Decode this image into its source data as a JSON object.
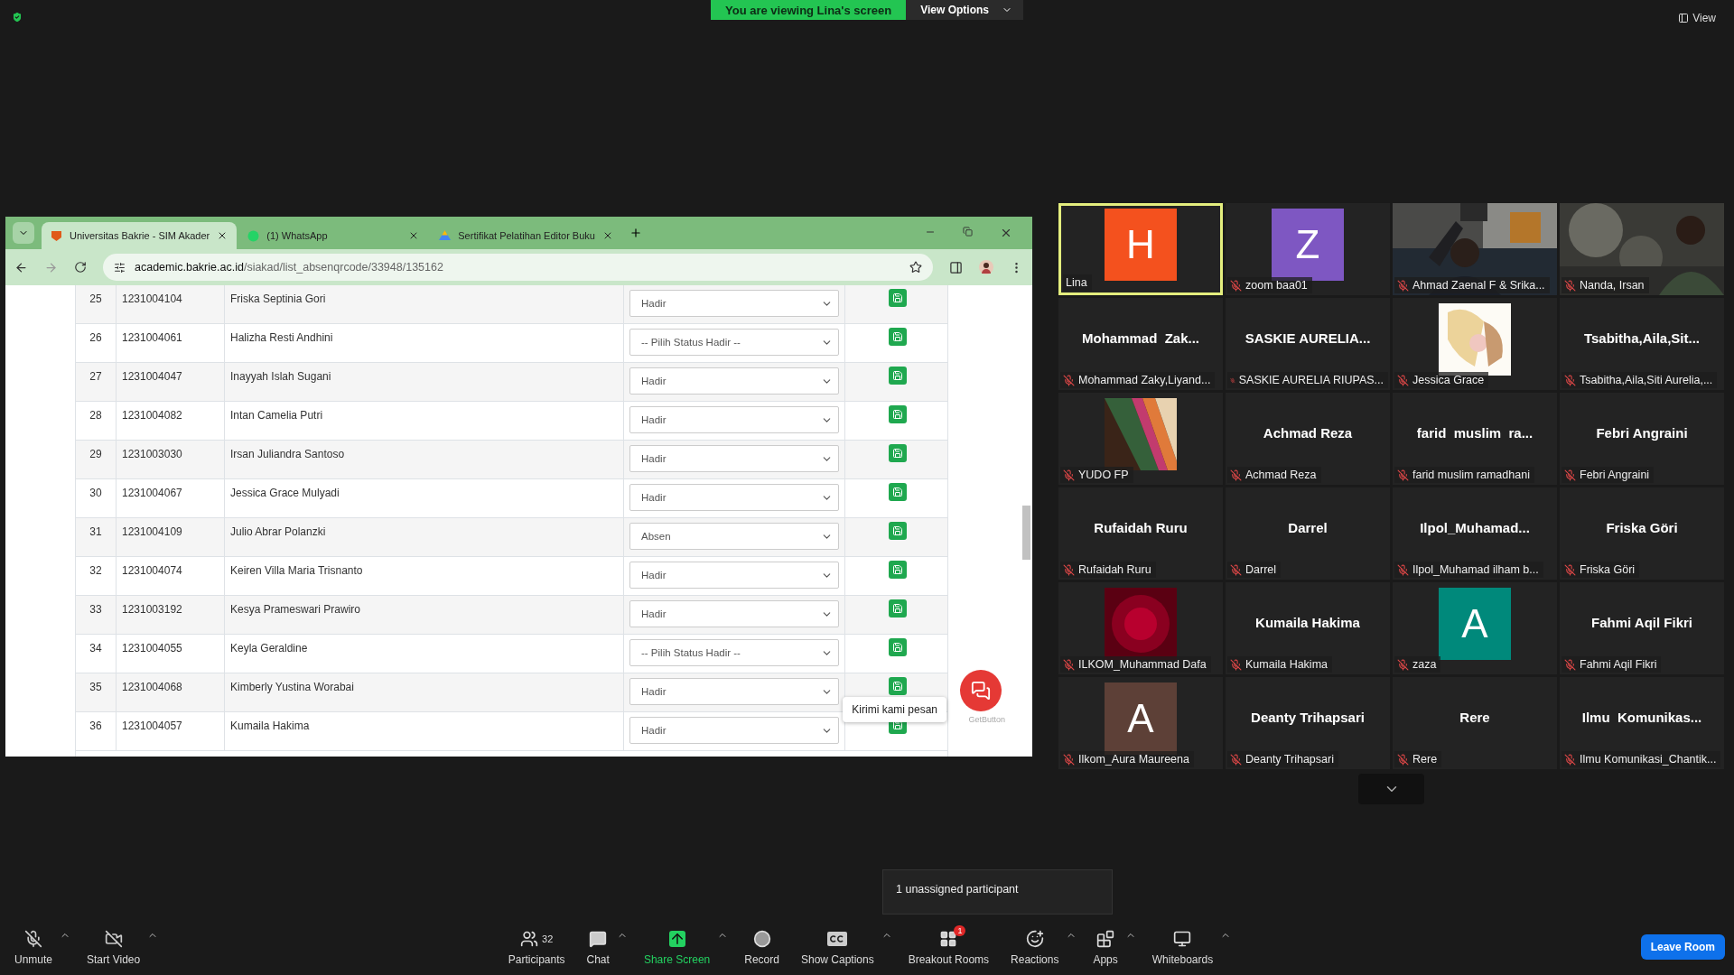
{
  "top_bar": {
    "viewing_label": "You are viewing Lina's screen",
    "view_options": "View Options",
    "view_button": "View"
  },
  "browser": {
    "tabs": [
      {
        "title": "Universitas Bakrie - SIM Akader",
        "selected": true,
        "kind": "shield"
      },
      {
        "title": "(1) WhatsApp",
        "selected": false,
        "kind": "chat"
      },
      {
        "title": "Sertifikat Pelatihan Editor Buku",
        "selected": false,
        "kind": "drive"
      }
    ],
    "url_host": "academic.bakrie.ac.id",
    "url_path": "/siakad/list_absenqrcode/33948/135162"
  },
  "table": {
    "rows": [
      {
        "no": "25",
        "nim": "1231004104",
        "name": "Friska Septinia Gori",
        "status": "Hadir"
      },
      {
        "no": "26",
        "nim": "1231004061",
        "name": "Halizha Resti Andhini",
        "status": "-- Pilih Status Hadir --"
      },
      {
        "no": "27",
        "nim": "1231004047",
        "name": "Inayyah Islah Sugani",
        "status": "Hadir"
      },
      {
        "no": "28",
        "nim": "1231004082",
        "name": "Intan Camelia Putri",
        "status": "Hadir"
      },
      {
        "no": "29",
        "nim": "1231003030",
        "name": "Irsan Juliandra Santoso",
        "status": "Hadir"
      },
      {
        "no": "30",
        "nim": "1231004067",
        "name": "Jessica Grace Mulyadi",
        "status": "Hadir"
      },
      {
        "no": "31",
        "nim": "1231004109",
        "name": "Julio Abrar Polanzki",
        "status": "Absen"
      },
      {
        "no": "32",
        "nim": "1231004074",
        "name": "Keiren Villa Maria Trisnanto",
        "status": "Hadir"
      },
      {
        "no": "33",
        "nim": "1231003192",
        "name": "Kesya Prameswari Prawiro",
        "status": "Hadir"
      },
      {
        "no": "34",
        "nim": "1231004055",
        "name": "Keyla Geraldine",
        "status": "-- Pilih Status Hadir --"
      },
      {
        "no": "35",
        "nim": "1231004068",
        "name": "Kimberly Yustina Worabai",
        "status": "Hadir"
      },
      {
        "no": "36",
        "nim": "1231004057",
        "name": "Kumaila Hakima",
        "status": "Hadir"
      }
    ]
  },
  "chat_widget": {
    "tooltip": "Kirimi kami pesan",
    "brand": "GetButton"
  },
  "participants": [
    {
      "kind": "avatar",
      "letter": "H",
      "color": "#f4511e",
      "label": "Lina",
      "muted": false,
      "speaking": true
    },
    {
      "kind": "avatar",
      "letter": "Z",
      "color": "#7e57c2",
      "label": "zoom baa01",
      "muted": true,
      "speaking": false
    },
    {
      "kind": "video",
      "label": "Ahmad Zaenal F & Srika...",
      "muted": true,
      "speaking": false
    },
    {
      "kind": "video",
      "label": "Nanda, Irsan",
      "muted": true,
      "speaking": false
    },
    {
      "kind": "name",
      "name": "Mohammad  Zak...",
      "label": "Mohammad Zaky,Liyand...",
      "muted": true,
      "speaking": false
    },
    {
      "kind": "name",
      "name": "SASKIE AURELIA...",
      "label": "SASKIE AURELIA RIUPAS...",
      "muted": true,
      "speaking": false
    },
    {
      "label": "Jessica Grace",
      "muted": true,
      "speaking": false
    },
    {
      "kind": "name",
      "name": "Tsabitha,Aila,Sit...",
      "label": "Tsabitha,Aila,Siti Aurelia,...",
      "muted": true,
      "speaking": false
    },
    {
      "label": "YUDO FP",
      "muted": true,
      "speaking": false
    },
    {
      "kind": "name",
      "name": "Achmad Reza",
      "label": "Achmad Reza",
      "muted": true,
      "speaking": false
    },
    {
      "kind": "name",
      "name": "farid  muslim  ra...",
      "label": "farid muslim ramadhani",
      "muted": true,
      "speaking": false
    },
    {
      "kind": "name",
      "name": "Febri Angraini",
      "label": "Febri Angraini",
      "muted": true,
      "speaking": false
    },
    {
      "kind": "name",
      "name": "Rufaidah Ruru",
      "label": "Rufaidah Ruru",
      "muted": true,
      "speaking": false
    },
    {
      "kind": "name",
      "name": "Darrel",
      "label": "Darrel",
      "muted": true,
      "speaking": false
    },
    {
      "kind": "name",
      "name": "Ilpol_Muhamad...",
      "label": "Ilpol_Muhamad ilham b...",
      "muted": true,
      "speaking": false
    },
    {
      "kind": "name",
      "name": "Friska Göri",
      "label": "Friska Göri",
      "muted": true,
      "speaking": false
    },
    {
      "label": "ILKOM_Muhammad Dafa",
      "muted": true,
      "speaking": false
    },
    {
      "kind": "name",
      "name": "Kumaila Hakima",
      "label": "Kumaila Hakima",
      "muted": true,
      "speaking": false
    },
    {
      "kind": "avatar",
      "letter": "A",
      "color": "#00897b",
      "label": "zaza",
      "muted": true,
      "speaking": false
    },
    {
      "kind": "name",
      "name": "Fahmi Aqil Fikri",
      "label": "Fahmi Aqil Fikri",
      "muted": true,
      "speaking": false
    },
    {
      "kind": "avatar",
      "letter": "A",
      "color": "#5d4037",
      "label": "Ilkom_Aura Maureena",
      "muted": true,
      "speaking": false
    },
    {
      "kind": "name",
      "name": "Deanty Trihapsari",
      "label": "Deanty Trihapsari",
      "muted": true,
      "speaking": false
    },
    {
      "kind": "name",
      "name": "Rere",
      "label": "Rere",
      "muted": true,
      "speaking": false
    },
    {
      "kind": "name",
      "name": "Ilmu  Komunikas...",
      "label": "Ilmu Komunikasi_Chantik...",
      "muted": true,
      "speaking": false
    }
  ],
  "popover": "1 unassigned participant",
  "toolbar": {
    "left": [
      {
        "kind": "unmute",
        "label": "Unmute",
        "caret": true
      },
      {
        "kind": "video",
        "label": "Start Video",
        "caret": true
      }
    ],
    "center": [
      {
        "kind": "participants",
        "label": "Participants",
        "caret": false,
        "count": "32"
      },
      {
        "kind": "chat",
        "label": "Chat",
        "caret": true
      },
      {
        "kind": "share",
        "label": "Share Screen",
        "caret": true
      },
      {
        "kind": "record",
        "label": "Record",
        "caret": false
      },
      {
        "kind": "captions",
        "label": "Show Captions",
        "caret": true
      },
      {
        "kind": "breakout",
        "label": "Breakout Rooms",
        "caret": false,
        "badge": "1"
      },
      {
        "kind": "reactions",
        "label": "Reactions",
        "caret": true
      },
      {
        "kind": "apps",
        "label": "Apps",
        "caret": true
      },
      {
        "kind": "whiteboards",
        "label": "Whiteboards",
        "caret": true
      }
    ],
    "leave": "Leave Room"
  }
}
